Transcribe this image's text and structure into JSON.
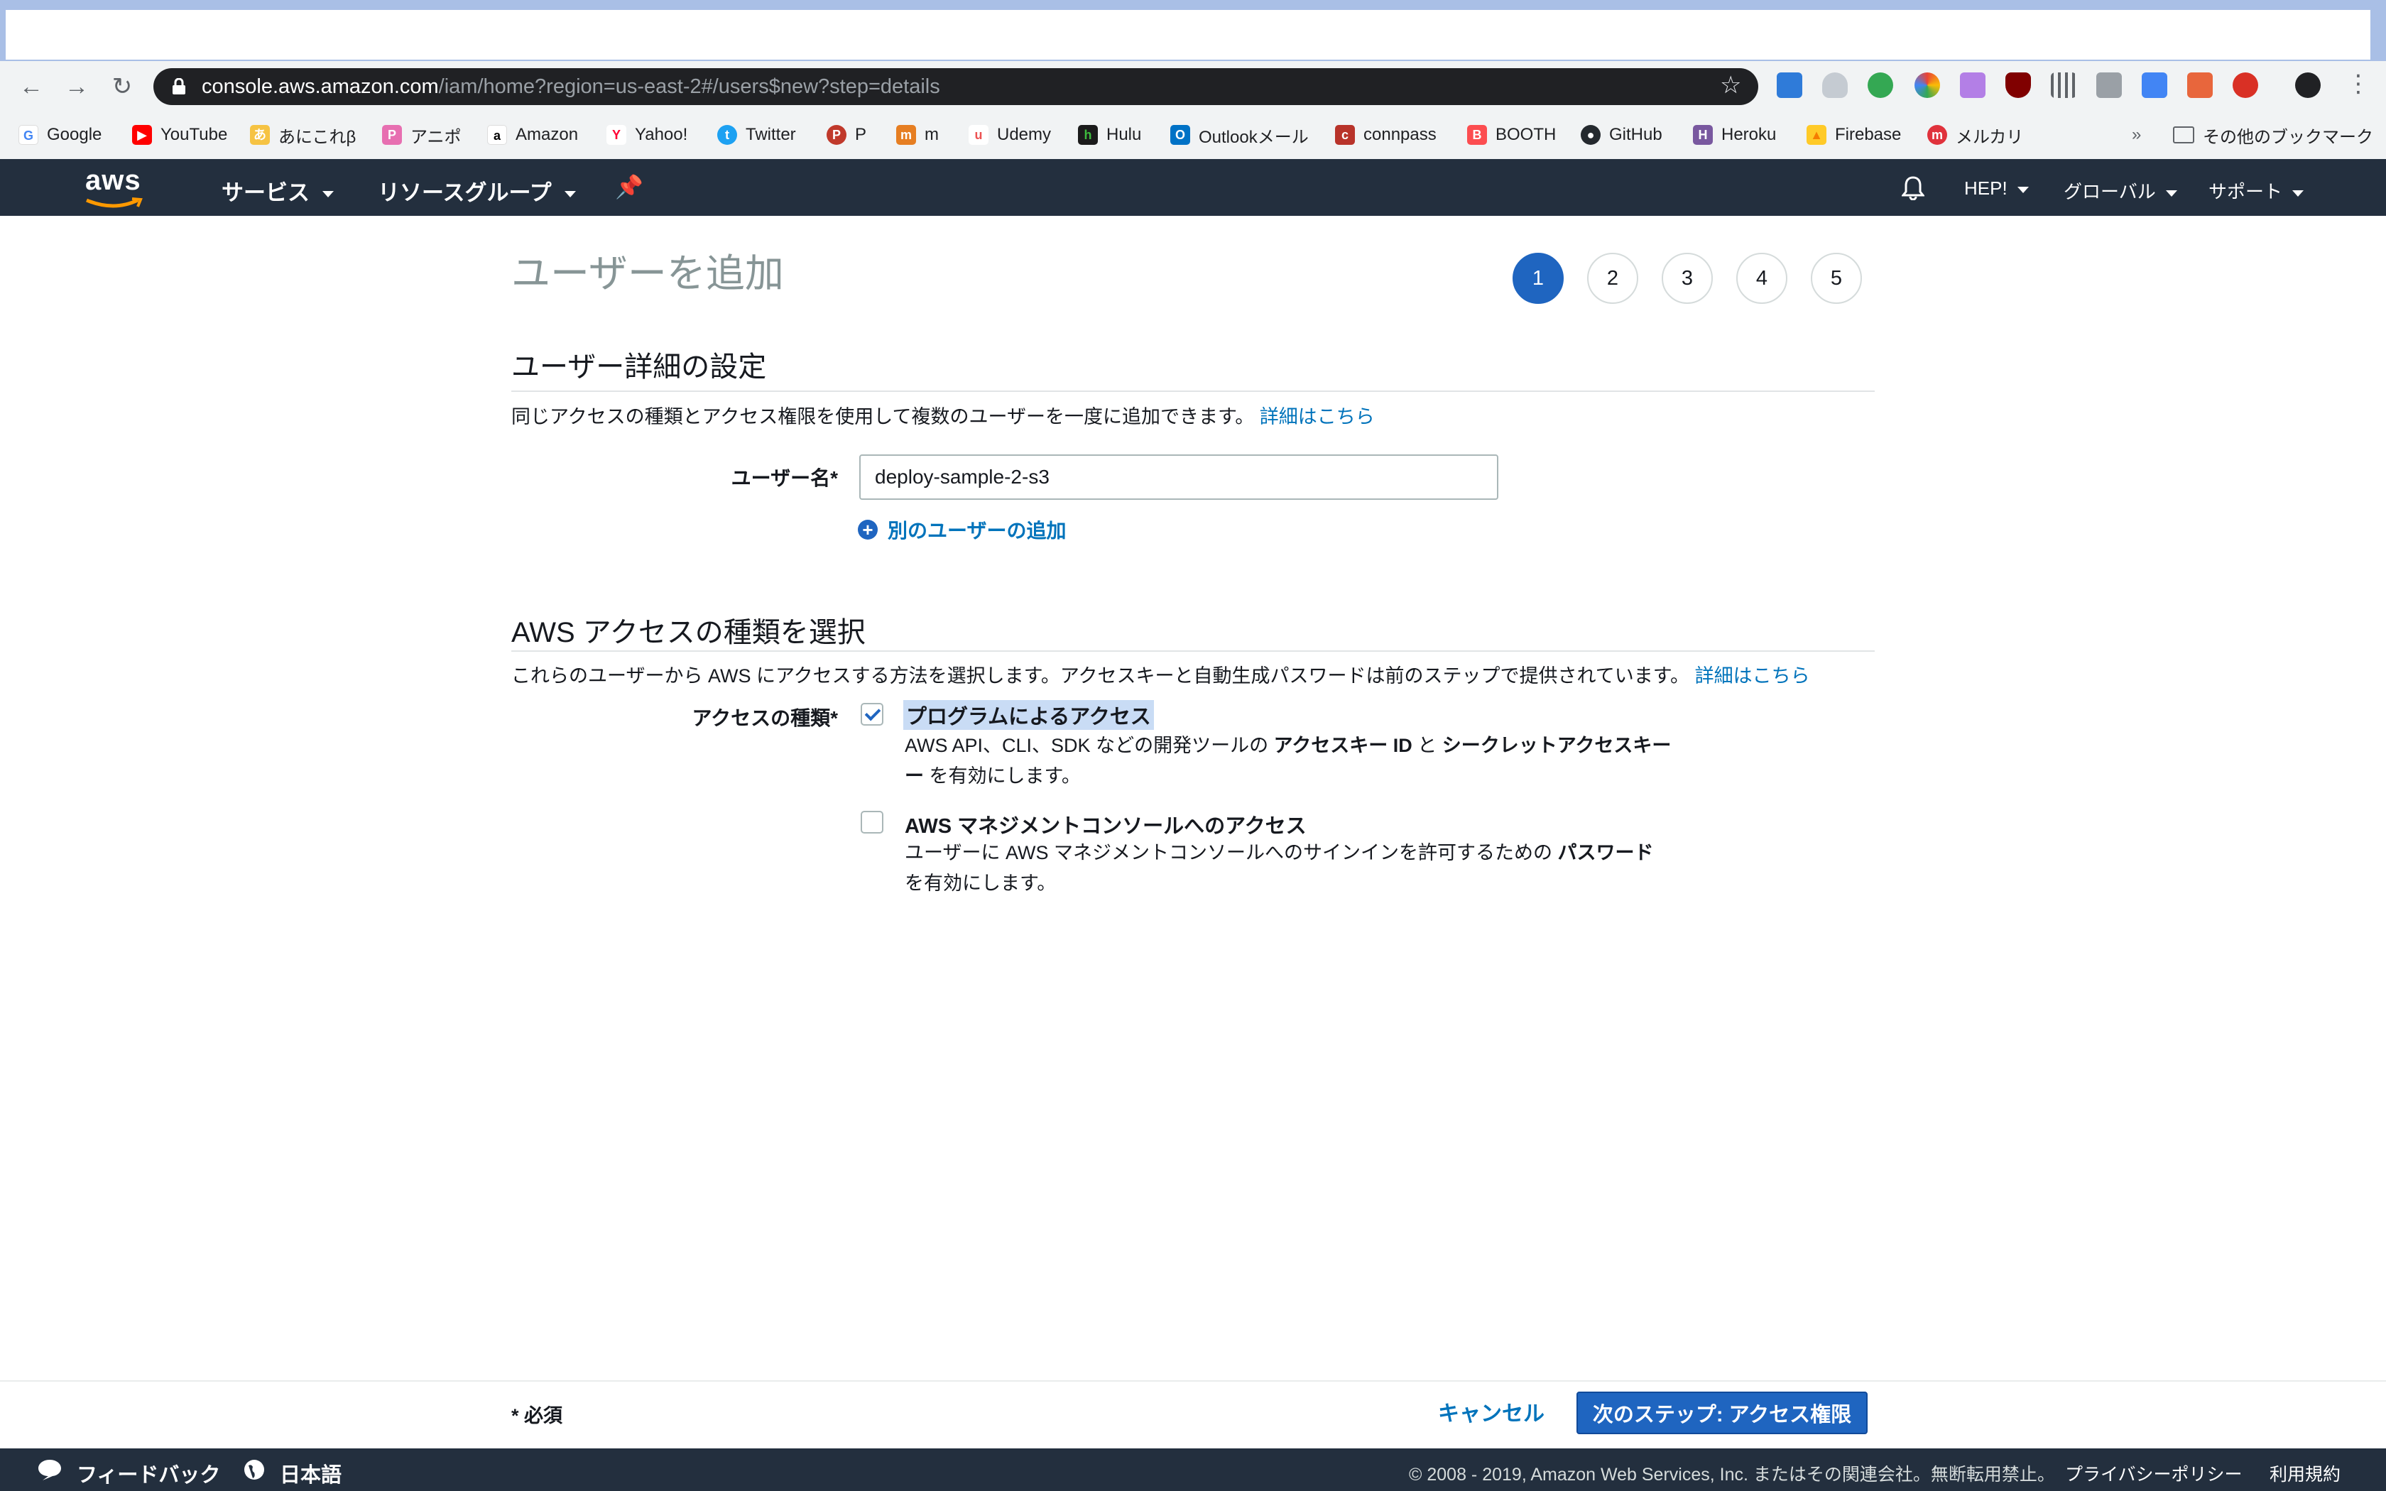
{
  "browser": {
    "url_host": "console.aws.amazon.com",
    "url_path": "/iam/home?region=us-east-2#/users$new?step=details",
    "bookmarks": [
      "Google",
      "YouTube",
      "あにこれβ",
      "アニポ",
      "Amazon",
      "Yahoo!",
      "Twitter",
      "P",
      "m",
      "Udemy",
      "Hulu",
      "Outlookメール",
      "connpass",
      "BOOTH",
      "GitHub",
      "Heroku",
      "Firebase",
      "メルカリ"
    ],
    "bookmarks_overflow": "»",
    "other_bookmarks": "その他のブックマーク"
  },
  "aws_nav": {
    "logo": "aws",
    "services": "サービス",
    "resource_groups": "リソースグループ",
    "account": "HEP!",
    "region": "グローバル",
    "support": "サポート"
  },
  "page": {
    "title": "ユーザーを追加",
    "steps": [
      "1",
      "2",
      "3",
      "4",
      "5"
    ],
    "active_step": "1"
  },
  "user_details": {
    "heading": "ユーザー詳細の設定",
    "description": "同じアクセスの種類とアクセス権限を使用して複数のユーザーを一度に追加できます。",
    "learn_more": "詳細はこちら",
    "username_label": "ユーザー名*",
    "username_value": "deploy-sample-2-s3",
    "add_user_link": "別のユーザーの追加"
  },
  "access_type": {
    "heading": "AWS アクセスの種類を選択",
    "description": "これらのユーザーから AWS にアクセスする方法を選択します。アクセスキーと自動生成パスワードは前のステップで提供されています。",
    "learn_more": "詳細はこちら",
    "label": "アクセスの種類*",
    "programmatic": {
      "title": "プログラムによるアクセス",
      "checked": true,
      "desc_1": "AWS API、CLI、SDK などの開発ツールの",
      "desc_bold_1": "アクセスキー ID",
      "desc_2": "と",
      "desc_bold_2": "シークレットアクセスキー",
      "desc_3": "を有効にします。"
    },
    "console": {
      "title": "AWS マネジメントコンソールへのアクセス",
      "checked": false,
      "desc_1": "ユーザーに AWS マネジメントコンソールへのサインインを許可するための",
      "desc_bold_1": "パスワード",
      "desc_2": "を有効にします。"
    }
  },
  "actions": {
    "required": "* 必須",
    "cancel": "キャンセル",
    "next": "次のステップ: アクセス権限"
  },
  "footer": {
    "feedback": "フィードバック",
    "language": "日本語",
    "copyright": "© 2008 - 2019, Amazon Web Services, Inc. またはその関連会社。無断転用禁止。",
    "privacy": "プライバシーポリシー",
    "terms": "利用規約"
  }
}
